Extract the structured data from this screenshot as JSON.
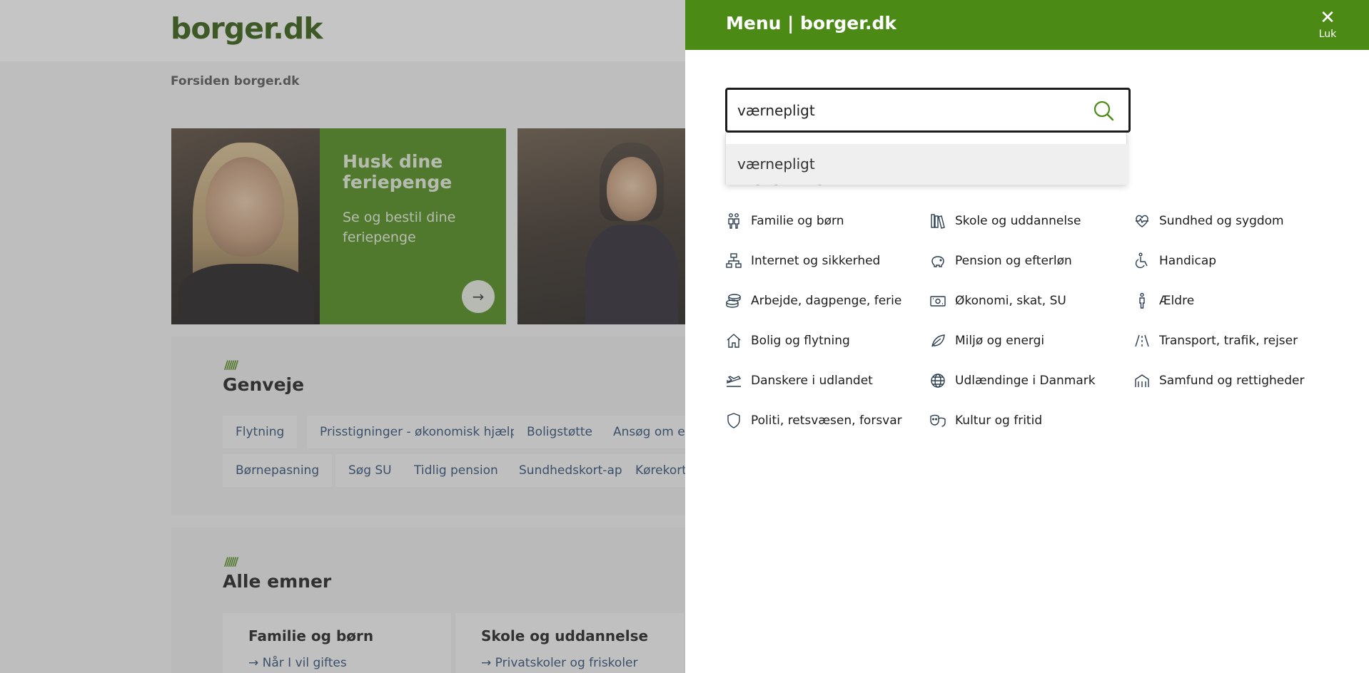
{
  "background": {
    "logo": "borger.dk",
    "breadcrumb": "Forsiden borger.dk",
    "cards": [
      {
        "title": "Husk dine feriepenge",
        "text": "Se og bestil dine feriepenge",
        "arrow": "→"
      }
    ],
    "genveje": {
      "stripes": "//////",
      "title": "Genveje",
      "row1": [
        "Flytning",
        "Prisstigninger - økonomisk hjælp",
        "Boligstøtte",
        "Ansøg om eller"
      ],
      "row2": [
        "Børnepasning",
        "Søg SU",
        "Tidlig pension",
        "Sundhedskort-app",
        "Kørekort"
      ]
    },
    "alle_emner": {
      "stripes": "//////",
      "title": "Alle emner",
      "cards": [
        {
          "title": "Familie og børn",
          "link": "Når I vil giftes"
        },
        {
          "title": "Skole og uddannelse",
          "link": "Privatskoler og friskoler"
        }
      ]
    }
  },
  "menu": {
    "title": "Menu | borger.dk",
    "close_label": "Luk",
    "close_icon": "close-icon",
    "search": {
      "value": "værnepligt",
      "icon": "search-icon",
      "suggestions": [
        "værnepligt"
      ]
    },
    "alle_emner_title": "Alle emner",
    "accent_color": "#4c8a16",
    "topics": [
      {
        "label": "Familie og børn",
        "icon": "family-icon"
      },
      {
        "label": "Skole og uddannelse",
        "icon": "books-icon"
      },
      {
        "label": "Sundhed og sygdom",
        "icon": "heart-pulse-icon"
      },
      {
        "label": "Internet og sikkerhed",
        "icon": "network-icon"
      },
      {
        "label": "Pension og efterløn",
        "icon": "piggy-bank-icon"
      },
      {
        "label": "Handicap",
        "icon": "wheelchair-icon"
      },
      {
        "label": "Arbejde, dagpenge, ferie",
        "icon": "coins-icon"
      },
      {
        "label": "Økonomi, skat, SU",
        "icon": "money-icon"
      },
      {
        "label": "Ældre",
        "icon": "elderly-icon"
      },
      {
        "label": "Bolig og flytning",
        "icon": "house-icon"
      },
      {
        "label": "Miljø og energi",
        "icon": "leaf-icon"
      },
      {
        "label": "Transport, trafik, rejser",
        "icon": "road-icon"
      },
      {
        "label": "Danskere i udlandet",
        "icon": "plane-icon"
      },
      {
        "label": "Udlændinge i Danmark",
        "icon": "globe-icon"
      },
      {
        "label": "Samfund og rettigheder",
        "icon": "building-icon"
      },
      {
        "label": "Politi, retsvæsen, forsvar",
        "icon": "shield-icon"
      },
      {
        "label": "Kultur og fritid",
        "icon": "masks-icon"
      }
    ]
  }
}
